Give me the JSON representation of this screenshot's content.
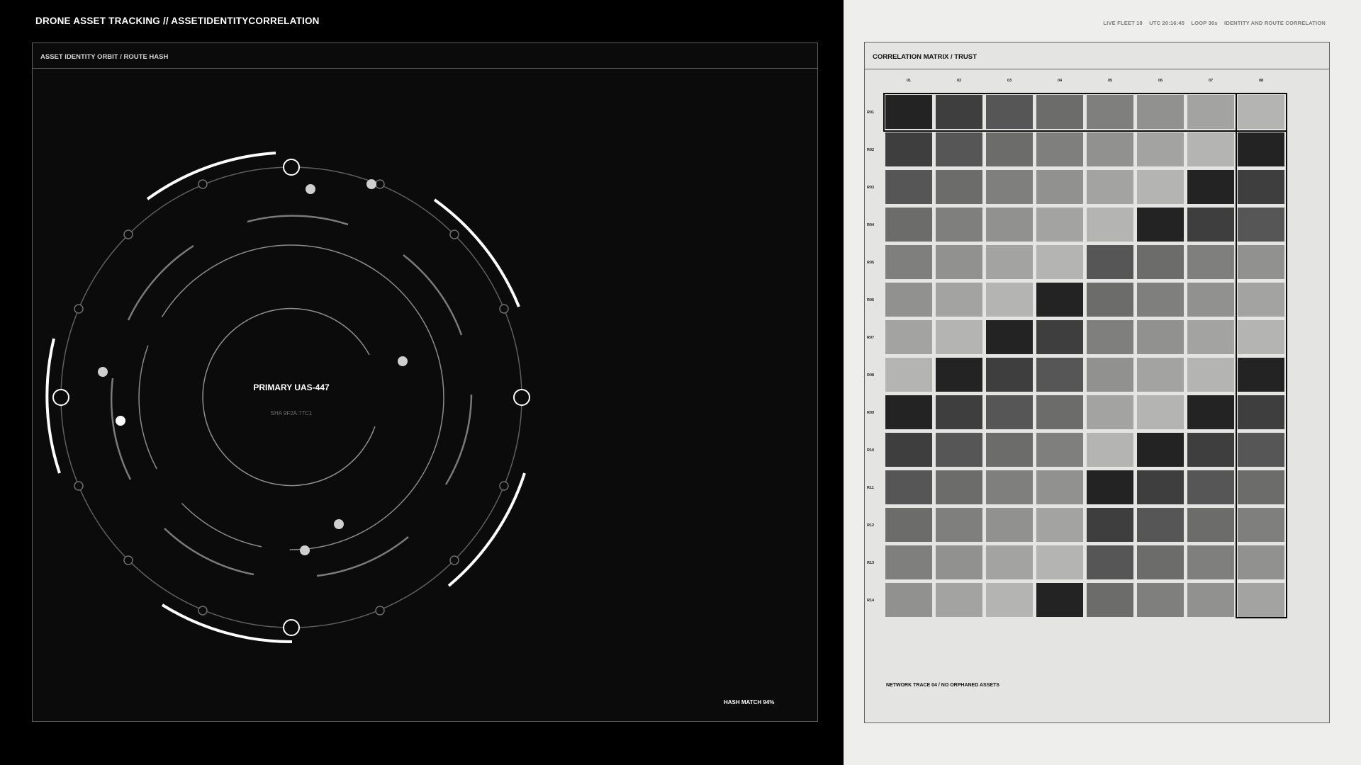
{
  "header": {
    "title": "DRONE ASSET TRACKING // ASSETIDENTITYCORRELATION",
    "status": [
      "LIVE FLEET 18",
      "UTC 20:16:45",
      "LOOP 30s",
      "IDENTITY AND ROUTE CORRELATION"
    ]
  },
  "orbit_panel": {
    "title": "ASSET IDENTITY ORBIT / ROUTE HASH",
    "primary_label": "PRIMARY UAS-447",
    "hash_label": "SHA 9F2A:77C1",
    "footer": "HASH MATCH 94%"
  },
  "matrix_panel": {
    "title": "CORRELATION MATRIX / TRUST",
    "columns": [
      "01",
      "02",
      "03",
      "04",
      "05",
      "06",
      "07",
      "08"
    ],
    "rows": [
      "R01",
      "R02",
      "R03",
      "R04",
      "R05",
      "R06",
      "R07",
      "R08",
      "R09",
      "R10",
      "R11",
      "R12",
      "R13",
      "R14"
    ],
    "highlighted_row": "R01",
    "highlighted_column": "08",
    "footer": "NETWORK TRACE 04 / NO ORPHANED ASSETS",
    "shade_palette": [
      "#222322",
      "#3d3e3d",
      "#555655",
      "#6c6d6b",
      "#7f807e",
      "#91928f",
      "#a3a4a1",
      "#b4b5b2"
    ]
  },
  "colors": {
    "left_background": "#000000",
    "right_background": "#eeefec",
    "orbit_stroke": "#ffffff",
    "dim_stroke": "#6a6a6a"
  }
}
